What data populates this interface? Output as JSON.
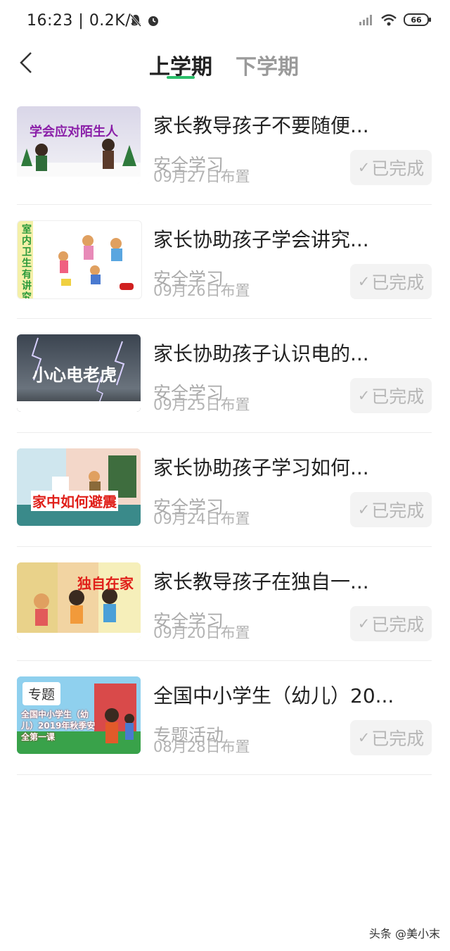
{
  "status_bar": {
    "time": "16:23",
    "speed": "0.2K/s",
    "battery": "66"
  },
  "header": {
    "tabs": [
      {
        "label": "上学期",
        "active": true
      },
      {
        "label": "下学期",
        "active": false
      }
    ],
    "accent_color": "#2bbf6a"
  },
  "items": [
    {
      "thumb_text": "学会应对陌生人",
      "title": "家长教导孩子不要随便...",
      "category": "安全学习",
      "date": "09月27日布置",
      "status": "已完成"
    },
    {
      "thumb_text": "室内卫生有讲究",
      "title": "家长协助孩子学会讲究...",
      "category": "安全学习",
      "date": "09月26日布置",
      "status": "已完成"
    },
    {
      "thumb_text": "小心电老虎",
      "title": "家长协助孩子认识电的...",
      "category": "安全学习",
      "date": "09月25日布置",
      "status": "已完成"
    },
    {
      "thumb_text": "家中如何避震",
      "title": "家长协助孩子学习如何...",
      "category": "安全学习",
      "date": "09月24日布置",
      "status": "已完成"
    },
    {
      "thumb_text": "独自在家",
      "title": "家长教导孩子在独自一...",
      "category": "安全学习",
      "date": "09月20日布置",
      "status": "已完成"
    },
    {
      "thumb_badge": "专题",
      "thumb_text": "全国中小学生（幼儿）2019年秋季安全第一课",
      "title": "全国中小学生（幼儿）20...",
      "category": "专题活动",
      "date": "08月28日布置",
      "status": "已完成"
    }
  ],
  "watermark": "头条 @美小末"
}
